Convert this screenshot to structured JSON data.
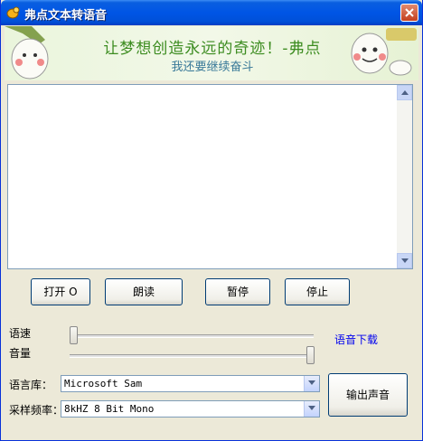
{
  "window": {
    "title": "弗点文本转语音"
  },
  "banner": {
    "main_text": "让梦想创造永远的奇迹！-弗点",
    "sub_text": "我还要继续奋斗"
  },
  "editor": {
    "value": ""
  },
  "buttons": {
    "open": "打开 O",
    "read": "朗读",
    "pause": "暂停",
    "stop": "停止",
    "output": "输出声音"
  },
  "sliders": {
    "speed_label": "语速",
    "volume_label": "音量",
    "speed_level": 0.0,
    "volume_level": 1.0
  },
  "link": {
    "voice_download": "语音下载"
  },
  "voice": {
    "label": "语言库：",
    "selected": "Microsoft Sam"
  },
  "rate": {
    "label": "采样频率：",
    "selected": "8kHZ 8 Bit Mono"
  },
  "colors": {
    "link": "#0000ee",
    "banner_text": "#3c8c20",
    "title_bar": "#0055e5"
  }
}
